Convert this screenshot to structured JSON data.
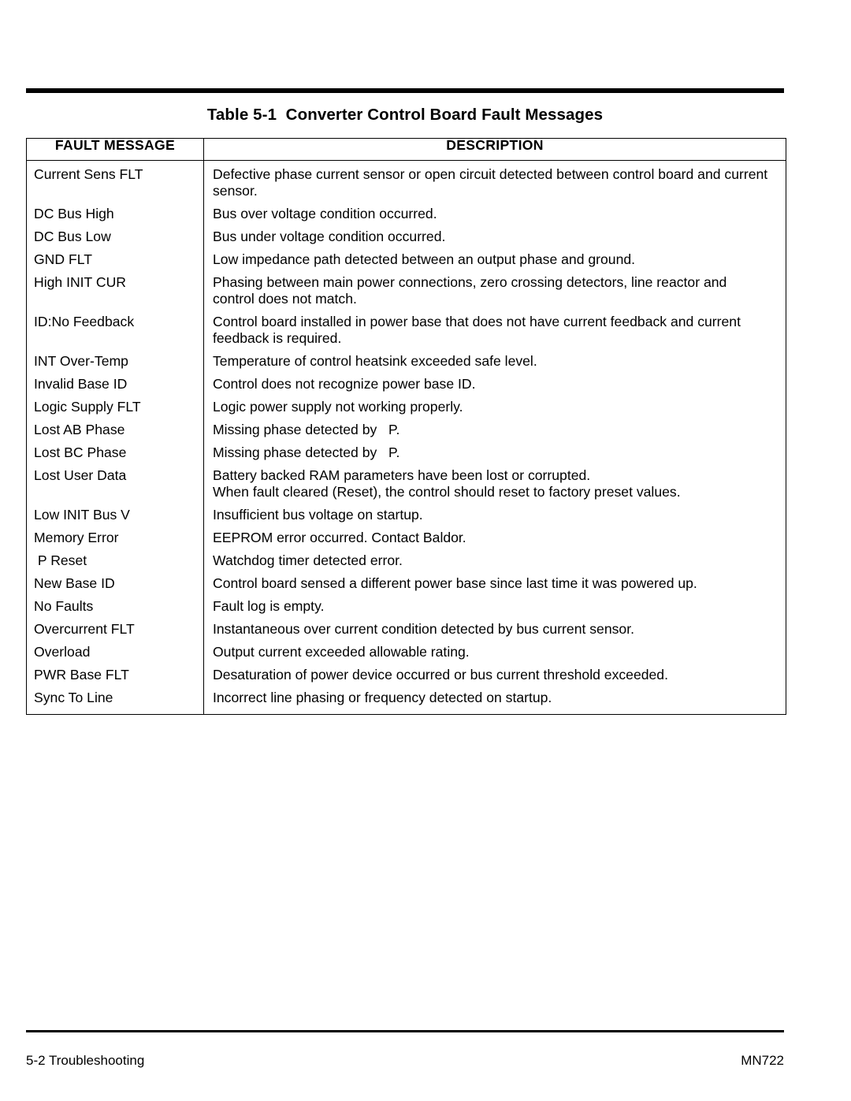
{
  "page": {
    "title_line": "Table 5-1  Converter Control Board Fault Messages"
  },
  "table": {
    "headers": {
      "fault_message": "FAULT MESSAGE",
      "description": "DESCRIPTION"
    },
    "rows": [
      {
        "message": "Current Sens FLT",
        "description": "Defective phase current sensor or open circuit detected between control board and current\nsensor."
      },
      {
        "message": "DC Bus High",
        "description": "Bus over voltage condition occurred."
      },
      {
        "message": "DC Bus Low",
        "description": "Bus under voltage condition occurred."
      },
      {
        "message": "GND FLT",
        "description": "Low impedance path detected between an output phase and ground."
      },
      {
        "message": "High INIT CUR",
        "description": "Phasing between main power connections, zero crossing detectors, line reactor and\ncontrol does not match."
      },
      {
        "message": "ID:No Feedback",
        "description": "Control board installed in power base that does not have current feedback and current\nfeedback is required."
      },
      {
        "message": "INT Over-Temp",
        "description": "Temperature of control heatsink exceeded safe level."
      },
      {
        "message": "Invalid Base ID",
        "description": "Control does not recognize power base ID."
      },
      {
        "message": "Logic Supply FLT",
        "description": "Logic power supply not working properly."
      },
      {
        "message": "Lost AB Phase",
        "description": "Missing phase detected by   P."
      },
      {
        "message": "Lost BC Phase",
        "description": "Missing phase detected by   P."
      },
      {
        "message": "Lost User Data",
        "description": "Battery backed RAM parameters have been lost or corrupted.\nWhen fault cleared (Reset), the control should reset to factory preset values.",
        "tight": true
      },
      {
        "message": "Low INIT Bus V",
        "description": "Insufficient bus voltage on startup."
      },
      {
        "message": "Memory Error",
        "description": "EEPROM error occurred. Contact Baldor."
      },
      {
        "message": " P Reset",
        "description": "Watchdog timer detected error."
      },
      {
        "message": "New Base ID",
        "description": "Control board sensed a different power base since last time it was powered up."
      },
      {
        "message": "No Faults",
        "description": "Fault log is empty."
      },
      {
        "message": "Overcurrent FLT",
        "description": "Instantaneous over current condition detected by bus current sensor."
      },
      {
        "message": "Overload",
        "description": "Output current exceeded allowable rating."
      },
      {
        "message": "PWR Base FLT",
        "description": "Desaturation of power device occurred or bus current threshold exceeded."
      },
      {
        "message": "Sync To Line",
        "description": "Incorrect line phasing or frequency detected on startup."
      }
    ]
  },
  "footer": {
    "left": "5-2 Troubleshooting",
    "right": "MN722"
  }
}
